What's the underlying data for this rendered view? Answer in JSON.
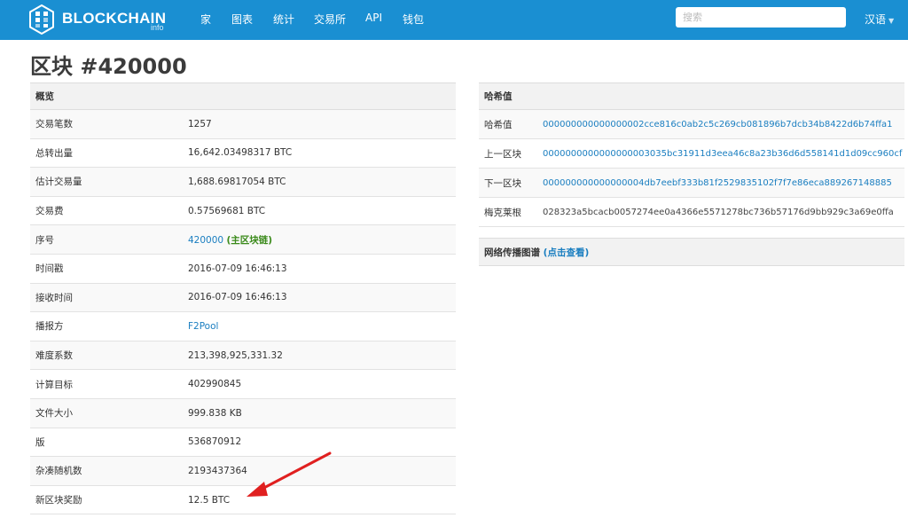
{
  "nav": {
    "brand": "BLOCKCHAIN",
    "brand_sub": "info",
    "items": [
      "家",
      "图表",
      "统计",
      "交易所",
      "API",
      "钱包"
    ],
    "search_placeholder": "搜索",
    "lang": "汉语"
  },
  "title": "区块 #420000",
  "summary": {
    "header": "概览",
    "rows": [
      {
        "label": "交易笔数",
        "value": "1257"
      },
      {
        "label": "总转出量",
        "value": "16,642.03498317 BTC"
      },
      {
        "label": "估计交易量",
        "value": "1,688.69817054 BTC"
      },
      {
        "label": "交易费",
        "value": "0.57569681 BTC"
      },
      {
        "label": "序号",
        "value": "420000",
        "extra": "(主区块链)"
      },
      {
        "label": "时间戳",
        "value": "2016-07-09 16:46:13"
      },
      {
        "label": "接收时间",
        "value": "2016-07-09 16:46:13"
      },
      {
        "label": "播报方",
        "value": "F2Pool"
      },
      {
        "label": "难度系数",
        "value": "213,398,925,331.32"
      },
      {
        "label": "计算目标",
        "value": "402990845"
      },
      {
        "label": "文件大小",
        "value": "999.838 KB"
      },
      {
        "label": "版",
        "value": "536870912"
      },
      {
        "label": "杂凑随机数",
        "value": "2193437364"
      },
      {
        "label": "新区块奖励",
        "value": "12.5 BTC"
      }
    ]
  },
  "hashes": {
    "header": "哈希值",
    "rows": [
      {
        "label": "哈希值",
        "value": "000000000000000002cce816c0ab2c5c269cb081896b7dcb34b8422d6b74ffa1"
      },
      {
        "label": "上一区块",
        "value": "0000000000000000003035bc31911d3eea46c8a23b36d6d558141d1d09cc960cf"
      },
      {
        "label": "下一区块",
        "value": "000000000000000004db7eebf333b81f2529835102f7f7e86eca889267148885"
      },
      {
        "label": "梅克莱根",
        "value": "028323a5bcacb0057274ee0a4366e5571278bc736b57176d9bb929c3a69e0ffa"
      }
    ]
  },
  "network": {
    "label": "网络传播图谱",
    "link": "(点击查看)"
  },
  "colors": {
    "navbar": "#1a8fd2",
    "link": "#1a7ec0",
    "main_chain": "#3a8a1a",
    "arrow": "#e02020"
  }
}
